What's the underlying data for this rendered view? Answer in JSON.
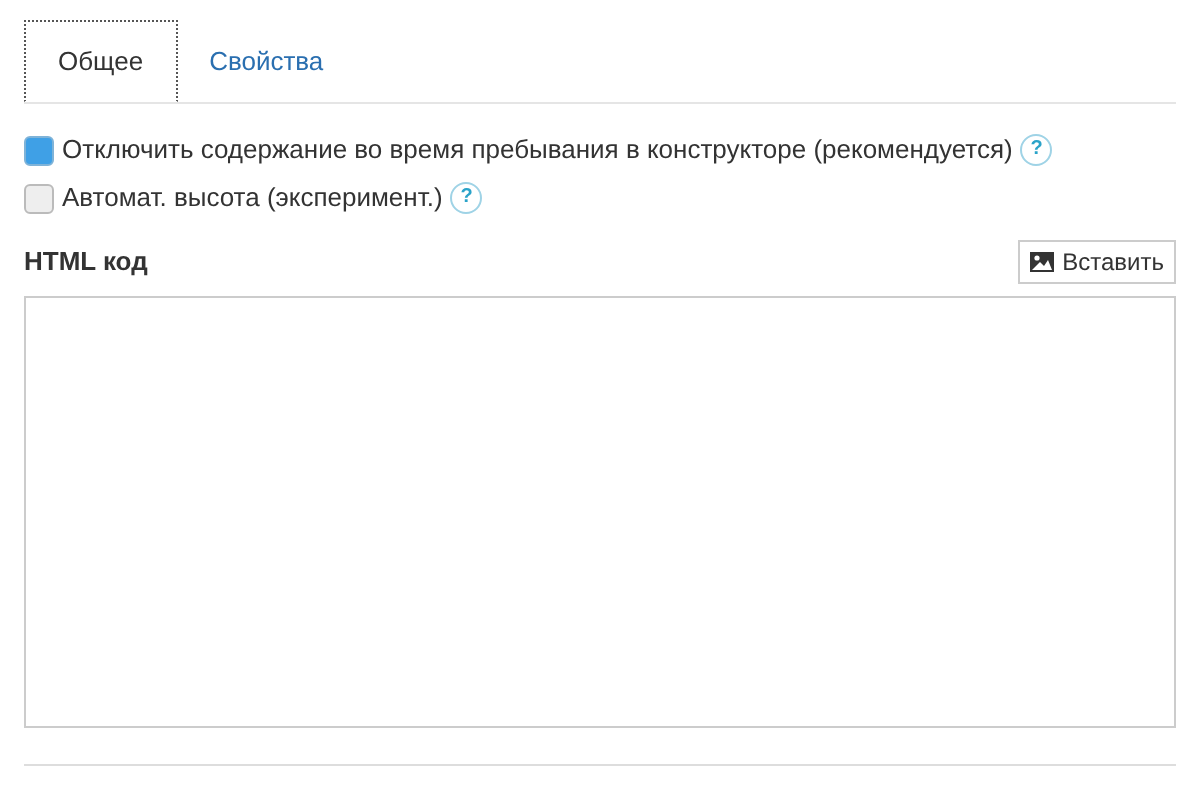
{
  "tabs": [
    {
      "label": "Общее",
      "selected": true
    },
    {
      "label": "Свойства",
      "selected": false
    }
  ],
  "options": [
    {
      "label": "Отключить содержание во время пребывания в конструкторе (рекомендуется)",
      "checked": true,
      "help": "?"
    },
    {
      "label": "Автомат. высота (эксперимент.)",
      "checked": false,
      "help": "?"
    }
  ],
  "html_code": {
    "label": "HTML код",
    "insert_button": "Вставить"
  }
}
